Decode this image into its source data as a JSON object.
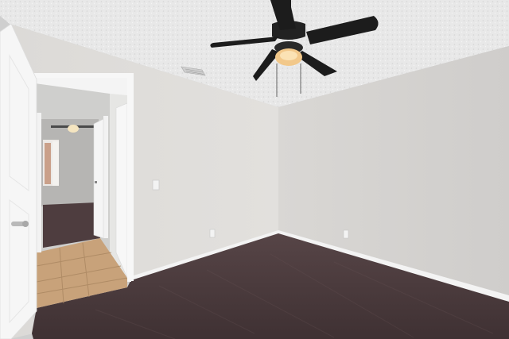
{
  "scene": {
    "type": "photo",
    "room": "empty-bedroom",
    "colors": {
      "ceiling": "#e9e9e9",
      "wall_left": "#dcdad7",
      "wall_right": "#d6d4d2",
      "carpet": "#4a3a3c",
      "baseboard": "#f3f3f3",
      "tile": "#c8a27a",
      "door_white": "#f6f6f6",
      "fan_black": "#1c1c1c",
      "fan_light": "#f2c88a"
    },
    "icons": [
      "ceiling-fan-icon",
      "air-vent-icon",
      "door-icon",
      "door-handle-icon",
      "light-switch-icon",
      "outlet-icon",
      "window-icon"
    ]
  }
}
